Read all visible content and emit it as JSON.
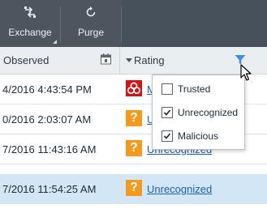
{
  "toolbar": {
    "exchange_label": "Exchange",
    "purge_label": "Purge",
    "exchange_icon": "exchange-arrows-icon",
    "purge_icon": "refresh-icon"
  },
  "columns": {
    "observed": "Observed",
    "rating": "Rating",
    "observed_icon": "calendar-icon",
    "rating_icon": "filter-funnel-icon"
  },
  "rows": [
    {
      "observed": "4/2016 4:43:54 PM",
      "rating": "M",
      "rating_icon": "biohazard-icon"
    },
    {
      "observed": "0/2016 2:03:07 AM",
      "rating": "Ur",
      "rating_icon": "question-icon"
    },
    {
      "observed": "7/2016 11:43:16 AM",
      "rating": "Unrecognized",
      "rating_icon": "question-icon"
    },
    {
      "observed": "7/2016 11:54:25 AM",
      "rating": "Unrecognized",
      "rating_icon": "question-icon",
      "selected": true
    }
  ],
  "filter_menu": {
    "options": [
      {
        "label": "Trusted",
        "checked": false
      },
      {
        "label": "Unrecognized",
        "checked": true
      },
      {
        "label": "Malicious",
        "checked": true
      }
    ]
  },
  "colors": {
    "toolbar_bg": "#4d565f",
    "header_bg": "#ebeef1",
    "selected_row": "#d3e6f5",
    "link": "#1d5fb0",
    "unrecognized_orange": "#f39a1c",
    "malicious_red": "#d01616",
    "filter_blue": "#3e8fd6"
  },
  "question_glyph": "?"
}
